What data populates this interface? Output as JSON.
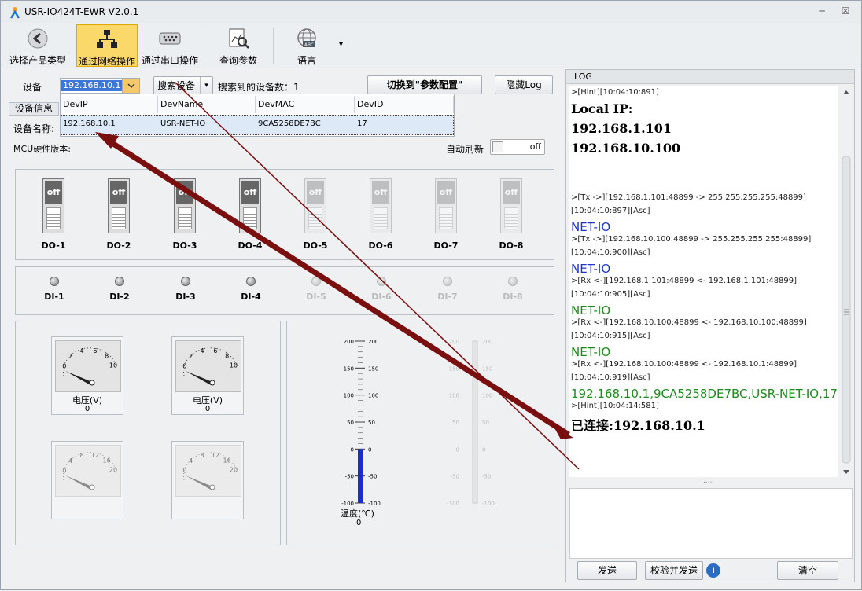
{
  "app": {
    "title": "USR-IO424T-EWR V2.0.1"
  },
  "window_buttons": {
    "minimize": "─",
    "close": "☒"
  },
  "toolbar": {
    "items": [
      {
        "label": "选择产品类型",
        "icon": "back-arrow-icon"
      },
      {
        "label": "通过网络操作",
        "icon": "network-icon"
      },
      {
        "label": "通过串口操作",
        "icon": "serial-port-icon"
      },
      {
        "label": "查询参数",
        "icon": "query-chart-icon"
      },
      {
        "label": "语言",
        "icon": "globe-abc-icon"
      }
    ],
    "dropdown_glyph": "▾"
  },
  "device_bar": {
    "device_label": "设备",
    "device_value": "192.168.10.1",
    "search_button": "搜索设备",
    "found_label": "搜索到的设备数：1",
    "switch_button": "切换到\"参数配置\"",
    "hide_log_button": "隐藏Log"
  },
  "dropdown": {
    "headers": [
      "DevIP",
      "DevName",
      "DevMAC",
      "DevID"
    ],
    "row": [
      "192.168.10.1",
      "USR-NET-IO",
      "9CA5258DE7BC",
      "17"
    ]
  },
  "device_info": {
    "tab": "设备信息",
    "name_label": "设备名称:",
    "mcu_label": "MCU硬件版本:",
    "auto_refresh_label": "自动刷新",
    "auto_refresh_state": "off"
  },
  "outputs": [
    {
      "label": "DO-1",
      "state": "off",
      "enabled": true
    },
    {
      "label": "DO-2",
      "state": "off",
      "enabled": true
    },
    {
      "label": "DO-3",
      "state": "off",
      "enabled": true
    },
    {
      "label": "DO-4",
      "state": "off",
      "enabled": true
    },
    {
      "label": "DO-5",
      "state": "off",
      "enabled": false
    },
    {
      "label": "DO-6",
      "state": "off",
      "enabled": false
    },
    {
      "label": "DO-7",
      "state": "off",
      "enabled": false
    },
    {
      "label": "DO-8",
      "state": "off",
      "enabled": false
    }
  ],
  "inputs": [
    {
      "label": "DI-1",
      "enabled": true
    },
    {
      "label": "DI-2",
      "enabled": true
    },
    {
      "label": "DI-3",
      "enabled": true
    },
    {
      "label": "DI-4",
      "enabled": true
    },
    {
      "label": "DI-5",
      "enabled": false
    },
    {
      "label": "DI-6",
      "enabled": false
    },
    {
      "label": "DI-7",
      "enabled": false
    },
    {
      "label": "DI-8",
      "enabled": false
    }
  ],
  "gauges": [
    {
      "label": "电压(V)",
      "value": "0",
      "scale": [
        "0",
        "2",
        "4",
        "6",
        "8",
        "10"
      ]
    },
    {
      "label": "电压(V)",
      "value": "0",
      "scale": [
        "0",
        "2",
        "4",
        "6",
        "8",
        "10"
      ]
    },
    {
      "label": "",
      "value": "",
      "scale": [
        "0",
        "4",
        "8",
        "12",
        "16",
        "20"
      ]
    },
    {
      "label": "",
      "value": "",
      "scale": [
        "0",
        "4",
        "8",
        "12",
        "16",
        "20"
      ]
    }
  ],
  "thermometer": {
    "label": "温度(℃)",
    "value": "0",
    "ticks": [
      "200",
      "150",
      "100",
      "50",
      "0",
      "-50",
      "-100"
    ],
    "fill_value": 0
  },
  "log": {
    "header": "LOG",
    "lines": [
      {
        "text": ">[Hint][10:04:10:891]",
        "style": "sm"
      },
      {
        "text": "Local IP:",
        "style": "big"
      },
      {
        "text": "192.168.1.101",
        "style": "big"
      },
      {
        "text": "192.168.10.100",
        "style": "big"
      },
      {
        "text": ">[Tx ->][192.168.1.101:48899 -> 255.255.255.255:48899]",
        "style": "sm"
      },
      {
        "text": "[10:04:10:897][Asc]",
        "style": "sm"
      },
      {
        "text": "NET-IO",
        "style": "blue"
      },
      {
        "text": ">[Tx ->][192.168.10.100:48899 -> 255.255.255.255:48899]",
        "style": "sm"
      },
      {
        "text": "[10:04:10:900][Asc]",
        "style": "sm"
      },
      {
        "text": "NET-IO",
        "style": "blue"
      },
      {
        "text": ">[Rx <-][192.168.1.101:48899 <- 192.168.1.101:48899]",
        "style": "sm"
      },
      {
        "text": "[10:04:10:905][Asc]",
        "style": "sm"
      },
      {
        "text": "NET-IO",
        "style": "green"
      },
      {
        "text": ">[Rx <-][192.168.10.100:48899 <- 192.168.10.100:48899]",
        "style": "sm"
      },
      {
        "text": "[10:04:10:915][Asc]",
        "style": "sm"
      },
      {
        "text": "NET-IO",
        "style": "green"
      },
      {
        "text": ">[Rx <-][192.168.10.100:48899 <- 192.168.10.1:48899]",
        "style": "sm"
      },
      {
        "text": "[10:04:10:919][Asc]",
        "style": "sm"
      },
      {
        "text": "192.168.10.1,9CA5258DE7BC,USR-NET-IO,17",
        "style": "green"
      },
      {
        "text": ">[Hint][10:04:14:581]",
        "style": "sm"
      },
      {
        "text": "已连接:192.168.10.1",
        "style": "big"
      }
    ],
    "splitter": "....",
    "send_button": "发送",
    "verify_send_button": "校验并发送",
    "info_icon": "i",
    "clear_button": "清空"
  },
  "colors": {
    "accent": "#fbd86a",
    "arrow": "#7a0f0f",
    "tx": "#1c35d0",
    "rx": "#1a8c1a"
  }
}
